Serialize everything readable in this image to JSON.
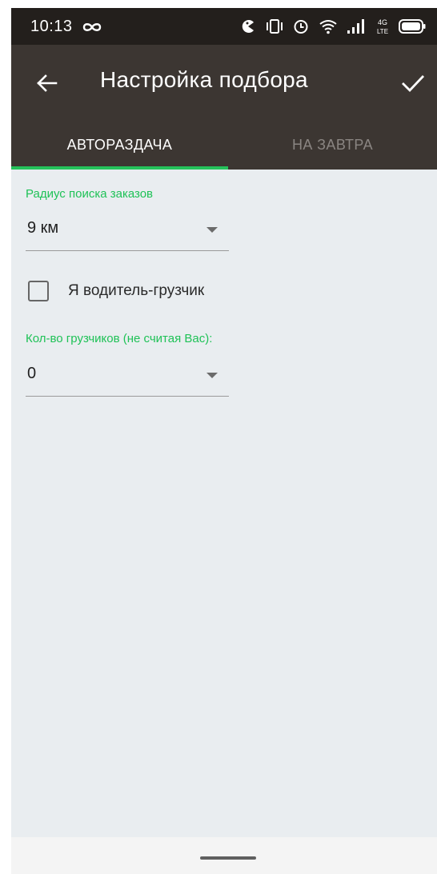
{
  "status_bar": {
    "time": "10:13",
    "icons": [
      "infinity-icon",
      "pacman-icon",
      "vibrate-icon",
      "alarm-icon",
      "wifi-icon",
      "signal-icon",
      "4g-lte-icon",
      "battery-icon"
    ],
    "network_badge_top": "4G",
    "network_badge_bottom": "LTE"
  },
  "app_bar": {
    "title": "Настройка подбора",
    "back_icon": "arrow-left-icon",
    "confirm_icon": "checkmark-icon"
  },
  "tabs": [
    {
      "label": "АВТОРАЗДАЧА",
      "active": true
    },
    {
      "label": "НА ЗАВТРА",
      "active": false
    }
  ],
  "form": {
    "radius": {
      "label": "Радиус поиска заказов",
      "value": "9 км"
    },
    "loader_driver": {
      "label": "Я водитель-грузчик",
      "checked": false
    },
    "loaders_count": {
      "label": "Кол-во грузчиков (не считая Вас):",
      "value": "0"
    }
  },
  "colors": {
    "accent": "#25c25b",
    "app_bar": "#3c3632",
    "status_bar": "#231f1c",
    "background": "#e9edf0"
  }
}
